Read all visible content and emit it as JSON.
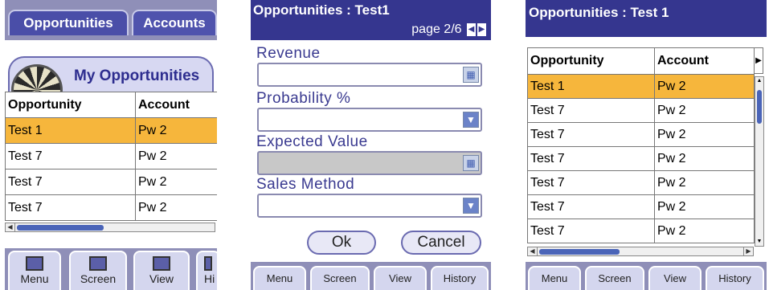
{
  "screen1": {
    "tabs": [
      "Opportunities",
      "Accounts"
    ],
    "list_title": "My Opportunities",
    "columns": [
      "Opportunity",
      "Account"
    ],
    "rows": [
      {
        "opportunity": "Test 1",
        "account": "Pw 2",
        "selected": true
      },
      {
        "opportunity": "Test 7",
        "account": "Pw 2",
        "selected": false
      },
      {
        "opportunity": "Test 7",
        "account": "Pw 2",
        "selected": false
      },
      {
        "opportunity": "Test 7",
        "account": "Pw 2",
        "selected": false
      }
    ],
    "bottom_tabs": [
      "Menu",
      "Screen",
      "View",
      "Hi"
    ]
  },
  "screen2": {
    "title": "Opportunities : Test1",
    "page_indicator": "page 2/6",
    "fields": [
      {
        "label": "Revenue",
        "value": "",
        "control": "calculator-icon",
        "disabled": false
      },
      {
        "label": "Probability %",
        "value": "",
        "control": "dropdown-arrow-icon",
        "disabled": false
      },
      {
        "label": "Expected Value",
        "value": "",
        "control": "calculator-icon",
        "disabled": true
      },
      {
        "label": "Sales Method",
        "value": "",
        "control": "dropdown-arrow-icon",
        "disabled": false
      }
    ],
    "ok_label": "Ok",
    "cancel_label": "Cancel",
    "bottom_tabs": [
      "Menu",
      "Screen",
      "View",
      "History"
    ]
  },
  "screen3": {
    "title": "Opportunities : Test 1",
    "columns": [
      "Opportunity",
      "Account"
    ],
    "rows": [
      {
        "opportunity": "Test 1",
        "account": "Pw 2",
        "selected": true
      },
      {
        "opportunity": "Test 7",
        "account": "Pw 2",
        "selected": false
      },
      {
        "opportunity": "Test 7",
        "account": "Pw 2",
        "selected": false
      },
      {
        "opportunity": "Test 7",
        "account": "Pw 2",
        "selected": false
      },
      {
        "opportunity": "Test 7",
        "account": "Pw 2",
        "selected": false
      },
      {
        "opportunity": "Test 7",
        "account": "Pw 2",
        "selected": false
      },
      {
        "opportunity": "Test 7",
        "account": "Pw 2",
        "selected": false
      }
    ],
    "bottom_tabs": [
      "Menu",
      "Screen",
      "View",
      "History"
    ]
  },
  "colors": {
    "title_bar": "#35368f",
    "tab_strip": "#8f8fb8",
    "selected_row": "#f6b63c",
    "field_label": "#3a3a90"
  }
}
